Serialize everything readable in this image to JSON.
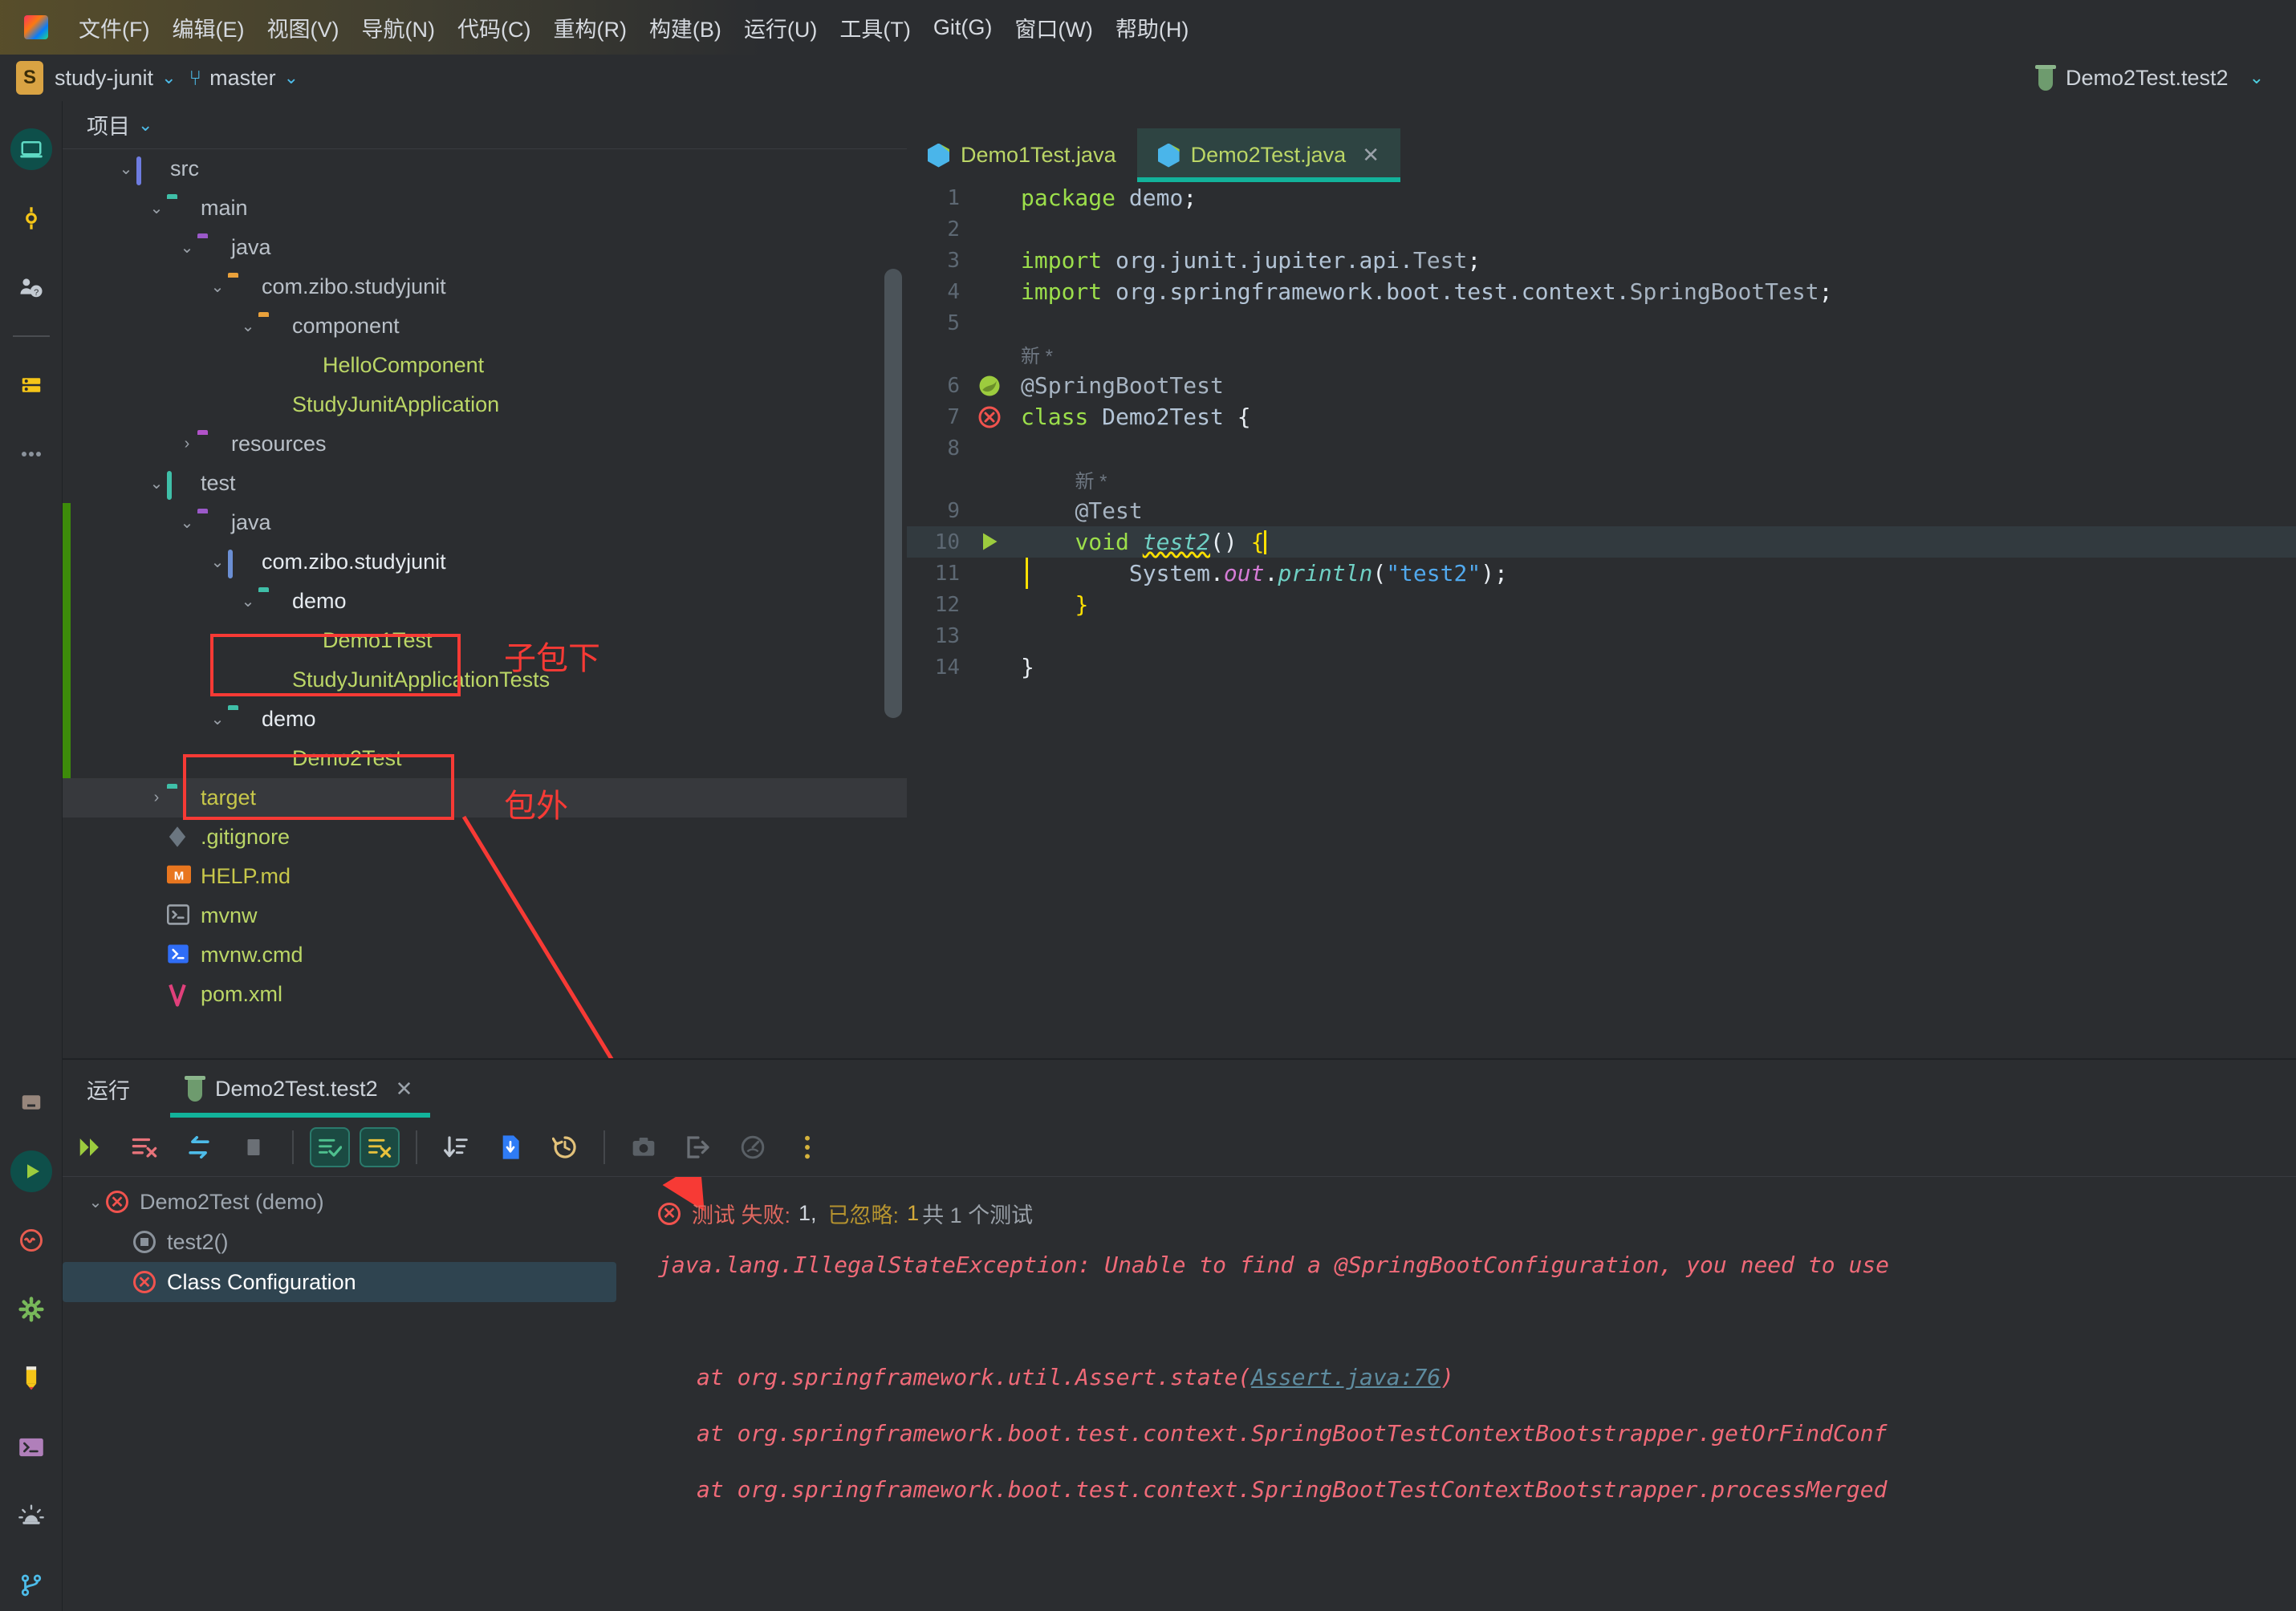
{
  "window": {
    "menu": [
      {
        "label": "文件(F)",
        "key": "F"
      },
      {
        "label": "编辑(E)",
        "key": "E"
      },
      {
        "label": "视图(V)",
        "key": "V"
      },
      {
        "label": "导航(N)",
        "key": "N"
      },
      {
        "label": "代码(C)",
        "key": "C"
      },
      {
        "label": "重构(R)",
        "key": "R"
      },
      {
        "label": "构建(B)",
        "key": "B"
      },
      {
        "label": "运行(U)",
        "key": "U"
      },
      {
        "label": "工具(T)",
        "key": "T"
      },
      {
        "label": "Git(G)",
        "key": "G"
      },
      {
        "label": "窗口(W)",
        "key": "W"
      },
      {
        "label": "帮助(H)",
        "key": "H"
      }
    ],
    "logo_letter": "IJ"
  },
  "navbar": {
    "project_initial": "S",
    "project_name": "study-junit",
    "branch_name": "master",
    "run_config": "Demo2Test.test2"
  },
  "rail": {
    "top": [
      {
        "name": "project-icon",
        "label": "项目"
      },
      {
        "name": "commit-icon",
        "label": "提交"
      },
      {
        "name": "pull-requests-icon",
        "label": "拉取请求"
      },
      {
        "name": "database-icon",
        "label": "数据库"
      },
      {
        "name": "more-tool-windows-icon",
        "label": "更多"
      }
    ],
    "bottom": [
      {
        "name": "structure-icon",
        "label": "结构"
      },
      {
        "name": "run-icon",
        "label": "运行"
      },
      {
        "name": "problems-icon",
        "label": "问题"
      },
      {
        "name": "services-icon",
        "label": "服务"
      },
      {
        "name": "notes-icon",
        "label": "笔记"
      },
      {
        "name": "terminal-icon",
        "label": "终端"
      },
      {
        "name": "notifications-icon",
        "label": "通知"
      },
      {
        "name": "git-icon",
        "label": "Git"
      }
    ]
  },
  "project_panel": {
    "title": "项目",
    "tree": [
      {
        "label": "src",
        "indent": 1,
        "arrow": "down",
        "icon": "folder-src",
        "color": "grey",
        "vcs": false
      },
      {
        "label": "main",
        "indent": 2,
        "arrow": "down",
        "icon": "folder-main",
        "color": "grey",
        "vcs": false
      },
      {
        "label": "java",
        "indent": 3,
        "arrow": "down",
        "icon": "folder-java",
        "color": "grey",
        "vcs": false
      },
      {
        "label": "com.zibo.studyjunit",
        "indent": 4,
        "arrow": "down",
        "icon": "folder-package",
        "color": "grey",
        "vcs": false
      },
      {
        "label": "component",
        "indent": 5,
        "arrow": "down",
        "icon": "folder-component",
        "color": "grey",
        "vcs": false
      },
      {
        "label": "HelloComponent",
        "indent": 6,
        "arrow": "none",
        "icon": "class-bean",
        "color": "green",
        "vcs": false
      },
      {
        "label": "StudyJunitApplication",
        "indent": 5,
        "arrow": "none",
        "icon": "class-bean",
        "color": "green",
        "vcs": false
      },
      {
        "label": "resources",
        "indent": 3,
        "arrow": "right",
        "icon": "folder-resources",
        "color": "grey",
        "vcs": false
      },
      {
        "label": "test",
        "indent": 2,
        "arrow": "down",
        "icon": "folder-test",
        "color": "grey",
        "vcs": false
      },
      {
        "label": "java",
        "indent": 3,
        "arrow": "down",
        "icon": "folder-java",
        "color": "grey",
        "vcs": true
      },
      {
        "label": "com.zibo.studyjunit",
        "indent": 4,
        "arrow": "down",
        "icon": "folder-pkg-blue",
        "color": "white",
        "vcs": true
      },
      {
        "label": "demo",
        "indent": 5,
        "arrow": "down",
        "icon": "folder-demo",
        "color": "white",
        "vcs": true
      },
      {
        "label": "Demo1Test",
        "indent": 6,
        "arrow": "none",
        "icon": "class-bean",
        "color": "green",
        "vcs": true
      },
      {
        "label": "StudyJunitApplicationTests",
        "indent": 5,
        "arrow": "none",
        "icon": "class-bean",
        "color": "green",
        "vcs": true
      },
      {
        "label": "demo",
        "indent": 4,
        "arrow": "down",
        "icon": "folder-demo",
        "color": "white",
        "vcs": true
      },
      {
        "label": "Demo2Test",
        "indent": 5,
        "arrow": "none",
        "icon": "class-bean",
        "color": "green",
        "vcs": true
      },
      {
        "label": "target",
        "indent": 2,
        "arrow": "right",
        "icon": "folder-target",
        "color": "olive",
        "vcs": false
      },
      {
        "label": ".gitignore",
        "indent": 2,
        "arrow": "none",
        "icon": "file-git",
        "color": "green",
        "vcs": false
      },
      {
        "label": "HELP.md",
        "indent": 2,
        "arrow": "none",
        "icon": "file-md",
        "color": "olive",
        "vcs": false
      },
      {
        "label": "mvnw",
        "indent": 2,
        "arrow": "none",
        "icon": "file-sh",
        "color": "green",
        "vcs": false
      },
      {
        "label": "mvnw.cmd",
        "indent": 2,
        "arrow": "none",
        "icon": "file-cmd",
        "color": "green",
        "vcs": false
      },
      {
        "label": "pom.xml",
        "indent": 2,
        "arrow": "none",
        "icon": "file-maven",
        "color": "green",
        "vcs": false
      }
    ]
  },
  "annotations": {
    "color": "#f73a35",
    "sub_package_label": "子包下",
    "outside_package_label": "包外"
  },
  "editor": {
    "tabs": [
      {
        "label": "Demo1Test.java",
        "active": false,
        "closable": false
      },
      {
        "label": "Demo2Test.java",
        "active": true,
        "closable": true
      }
    ],
    "close_glyph": "✕",
    "lines": [
      {
        "num": "1",
        "gutter": "",
        "text_html": "<span class=\"k\">package</span> <span class=\"cls\">demo</span><span class=\"wht\">;</span>"
      },
      {
        "num": "2",
        "gutter": "",
        "text_html": ""
      },
      {
        "num": "3",
        "gutter": "",
        "text_html": "<span class=\"k\">import</span> <span class=\"cls\">org.junit.jupiter.api.</span><span class=\"ann\">Test</span><span class=\"wht\">;</span>"
      },
      {
        "num": "4",
        "gutter": "",
        "text_html": "<span class=\"k\">import</span> <span class=\"cls\">org.springframework.boot.test.context.</span><span class=\"ann\">SpringBootTest</span><span class=\"wht\">;</span>"
      },
      {
        "num": "5",
        "gutter": "",
        "text_html": ""
      },
      {
        "num": "",
        "gutter": "",
        "text_html": "<span class=\"hint\">新 *</span>"
      },
      {
        "num": "6",
        "gutter": "spring",
        "text_html": "<span class=\"ann\">@SpringBootTest</span>"
      },
      {
        "num": "7",
        "gutter": "error",
        "text_html": "<span class=\"k\">class</span> <span class=\"cls\">Demo2Test</span> <span class=\"wht\">{</span>"
      },
      {
        "num": "8",
        "gutter": "",
        "text_html": ""
      },
      {
        "num": "",
        "gutter": "",
        "text_html": "    <span class=\"hint\">新 *</span>"
      },
      {
        "num": "9",
        "gutter": "",
        "text_html": "    <span class=\"ann\">@Test</span>"
      },
      {
        "num": "10",
        "gutter": "run",
        "hl": true,
        "text_html": "    <span class=\"k\">void</span> <span class=\"meth sq\">test2</span><span class=\"wht\">()</span> <span class=\"ylw\">{</span><span class=\"caret\"></span>"
      },
      {
        "num": "11",
        "gutter": "",
        "guide": true,
        "text_html": "        <span class=\"cls\">System</span><span class=\"wht\">.</span><span class=\"fld\">out</span><span class=\"wht\">.</span><span class=\"meth\">println</span><span class=\"wht\">(</span><span class=\"str\">\"test2\"</span><span class=\"wht\">);</span>"
      },
      {
        "num": "12",
        "gutter": "",
        "text_html": "    <span class=\"ylw\">}</span>"
      },
      {
        "num": "13",
        "gutter": "",
        "text_html": ""
      },
      {
        "num": "14",
        "gutter": "",
        "text_html": "<span class=\"wht\">}</span>"
      }
    ]
  },
  "run_panel": {
    "title": "运行",
    "tab_label": "Demo2Test.test2",
    "close_glyph": "✕",
    "toolbar": [
      {
        "name": "rerun-failed-tests-button",
        "glyph": "rerun"
      },
      {
        "name": "stop-and-clear-button",
        "glyph": "clear"
      },
      {
        "name": "toggle-auto-test-button",
        "glyph": "autotest"
      },
      {
        "name": "stop-button",
        "glyph": "stop"
      },
      {
        "name": "show-passed-button",
        "glyph": "passed",
        "toggled": true
      },
      {
        "name": "show-ignored-button",
        "glyph": "ignored",
        "toggled": true
      },
      {
        "name": "sort-by-duration-button",
        "glyph": "sort"
      },
      {
        "name": "export-test-results-button",
        "glyph": "export"
      },
      {
        "name": "test-history-button",
        "glyph": "history"
      },
      {
        "name": "screenshot-button",
        "glyph": "camera"
      },
      {
        "name": "export-button",
        "glyph": "arrow-out"
      },
      {
        "name": "profiler-button",
        "glyph": "gauge"
      },
      {
        "name": "more-options-button",
        "glyph": "dots"
      }
    ],
    "test_tree": [
      {
        "label": "Demo2Test (demo)",
        "status": "failed",
        "indent": 0,
        "arrow": "down",
        "selected": false
      },
      {
        "label": "test2()",
        "status": "ignored",
        "indent": 1,
        "arrow": "none",
        "selected": false
      },
      {
        "label": "Class Configuration",
        "status": "failed",
        "indent": 1,
        "arrow": "none",
        "selected": true
      }
    ],
    "status": {
      "failed_label": "测试 失败:",
      "failed_count": "1,",
      "ignored_label": "已忽略:",
      "ignored_count": "1",
      "total_label": "共 1 个测试"
    },
    "console": [
      {
        "text": "java.lang.IllegalStateException: Unable to find a @SpringBootConfiguration, you need to use",
        "indent": false,
        "link": ""
      },
      {
        "text": "",
        "indent": false,
        "link": ""
      },
      {
        "text": "at org.springframework.util.Assert.state(",
        "indent": true,
        "link": "Assert.java:76",
        "tail": ")"
      },
      {
        "text": "at org.springframework.boot.test.context.SpringBootTestContextBootstrapper.getOrFindConf",
        "indent": true,
        "link": ""
      },
      {
        "text": "at org.springframework.boot.test.context.SpringBootTestContextBootstrapper.processMerged",
        "indent": true,
        "link": ""
      }
    ]
  }
}
